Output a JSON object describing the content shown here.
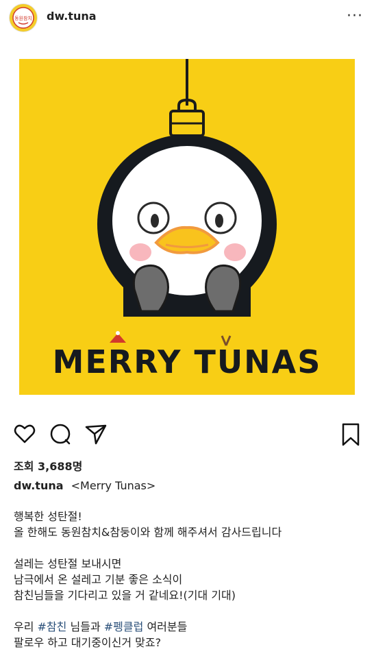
{
  "header": {
    "username": "dw.tuna",
    "avatar_text": "동원참치",
    "more_label": "···"
  },
  "post_image": {
    "text": "MERRY TUNAS",
    "background": "#f8ce15",
    "title_color": "#161a1f",
    "accent": "#f19a3e"
  },
  "actions": {
    "like_icon": "heart-icon",
    "comment_icon": "comment-icon",
    "share_icon": "send-icon",
    "save_icon": "bookmark-icon"
  },
  "stats": {
    "views": "조회 3,688명"
  },
  "caption": {
    "username": "dw.tuna",
    "title": "<Merry Tunas>",
    "lines": [
      "행복한 성탄절!",
      "올 한해도 동원참치&참둥이와 함께 해주셔서 감사드립니다",
      "설레는 성탄절 보내시면",
      "남극에서 온 설레고 기분 좋은 소식이",
      "참친님들을 기다리고 있을 거 같네요!(기대 기대)",
      "우리",
      "#참친",
      "님들과",
      "#펭클럽",
      "여러분들",
      "팔로우 하고 대기중이신거 맞죠?"
    ]
  }
}
